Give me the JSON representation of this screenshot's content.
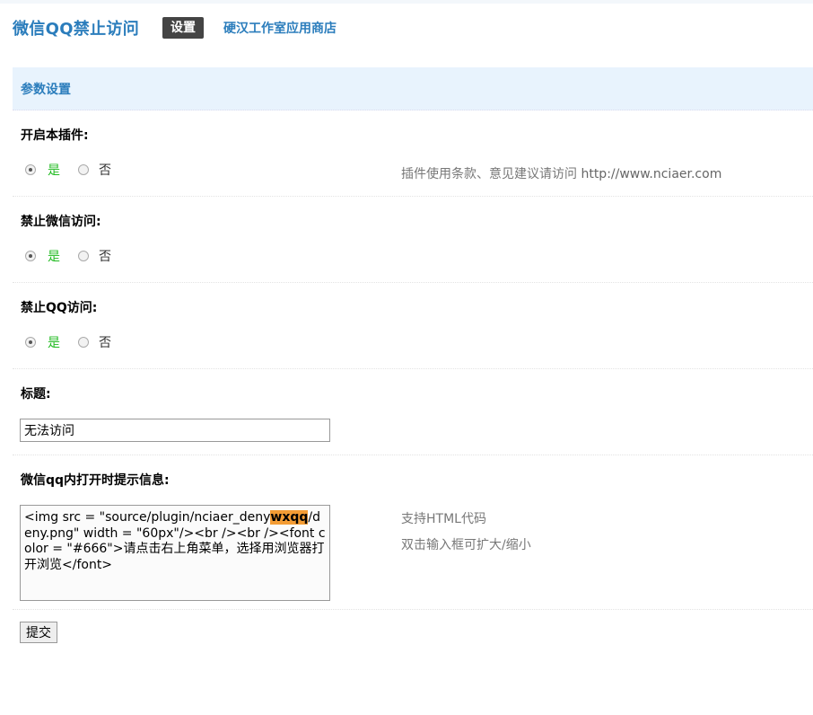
{
  "header": {
    "plugin_title": "微信QQ禁止访问",
    "tab_settings": "设置",
    "store_link": "硬汉工作室应用商店"
  },
  "section": {
    "title": "参数设置"
  },
  "settings": {
    "enable_plugin": {
      "label": "开启本插件:",
      "yes": "是",
      "no": "否",
      "selected": "是"
    },
    "block_wechat": {
      "label": "禁止微信访问:",
      "yes": "是",
      "no": "否",
      "selected": "是"
    },
    "block_qq": {
      "label": "禁止QQ访问:",
      "yes": "是",
      "no": "否",
      "selected": "是"
    },
    "title_field": {
      "label": "标题:",
      "value": "无法访问"
    },
    "message_field": {
      "label": "微信qq内打开时提示信息:",
      "value_before": "<img src = \"source/plugin/nciaer_deny",
      "value_highlight": "wxqq",
      "value_after": "/deny.png\" width = \"60px\"/><br /><br /><font color = \"#666\">请点击右上角菜单，选择用浏览器打开浏览</font>"
    }
  },
  "hints": {
    "terms_text": "插件使用条款、意见建议请访问",
    "terms_url": "http://www.nciaer.com",
    "html_support": "支持HTML代码",
    "dblclick_resize": "双击输入框可扩大/缩小"
  },
  "submit_label": "提交",
  "colors": {
    "accent": "#2b7dbc",
    "yes_green": "#22bb22",
    "section_bg": "#e8f3fd",
    "highlight": "#f39c34"
  }
}
